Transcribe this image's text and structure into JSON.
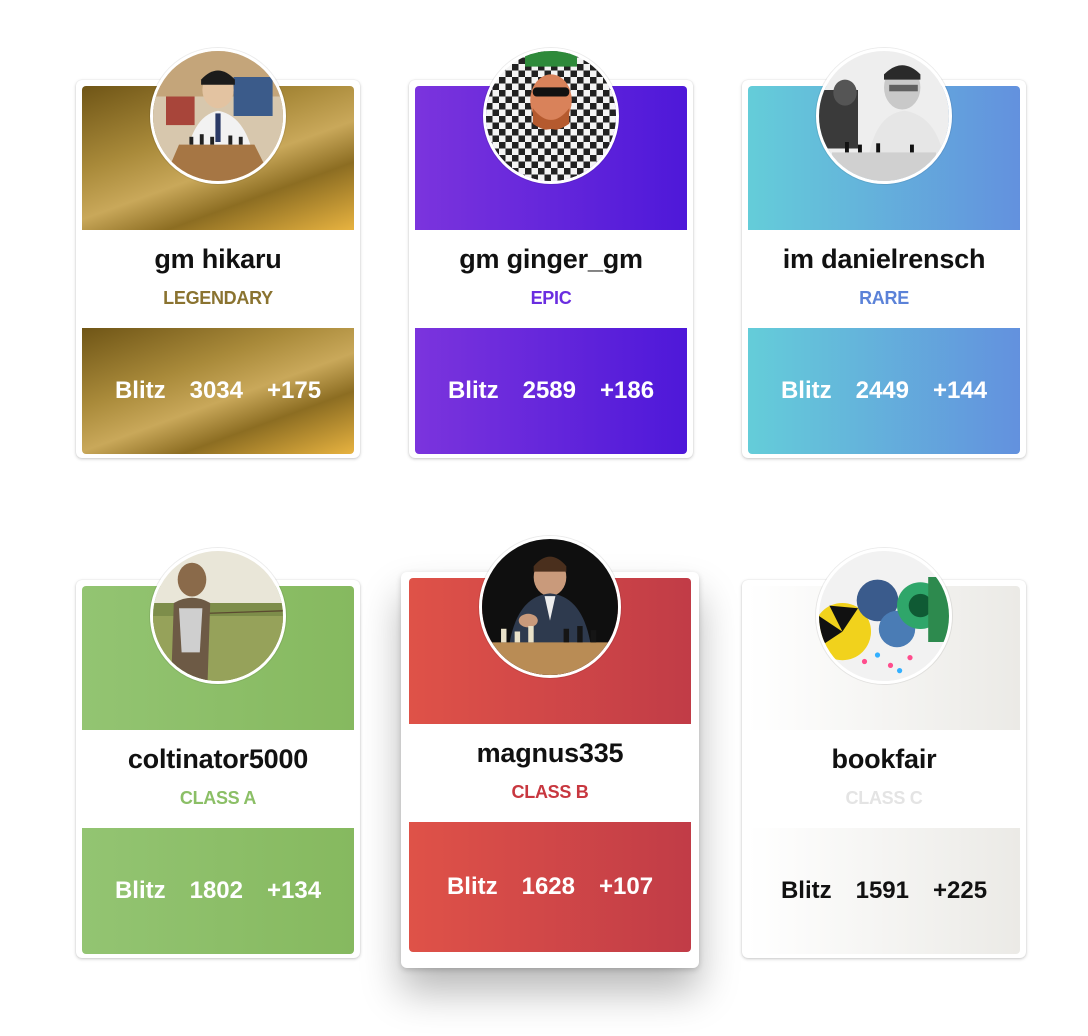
{
  "colors": {
    "legendary": "#8a7330",
    "epic": "#6a2de0",
    "rare": "#5b82d8",
    "class_a": "#8bbf66",
    "class_b": "#c8373f",
    "class_c": "#e4e4e4"
  },
  "cards": [
    {
      "name": "gm hikaru",
      "tier": "LEGENDARY",
      "mode": "Blitz",
      "rating": "3034",
      "change": "+175"
    },
    {
      "name": "gm ginger_gm",
      "tier": "EPIC",
      "mode": "Blitz",
      "rating": "2589",
      "change": "+186"
    },
    {
      "name": "im danielrensch",
      "tier": "RARE",
      "mode": "Blitz",
      "rating": "2449",
      "change": "+144"
    },
    {
      "name": "coltinator5000",
      "tier": "CLASS A",
      "mode": "Blitz",
      "rating": "1802",
      "change": "+134"
    },
    {
      "name": "magnus335",
      "tier": "CLASS B",
      "mode": "Blitz",
      "rating": "1628",
      "change": "+107"
    },
    {
      "name": "bookfair",
      "tier": "CLASS C",
      "mode": "Blitz",
      "rating": "1591",
      "change": "+225"
    }
  ]
}
